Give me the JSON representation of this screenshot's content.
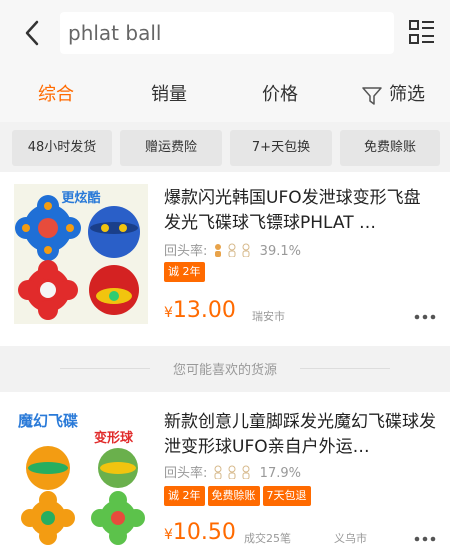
{
  "search": {
    "query": "phlat ball"
  },
  "icons": {
    "back": "chevron-left-icon",
    "list": "list-view-icon",
    "filter": "funnel-icon",
    "more": "more-dots-icon"
  },
  "tabs": [
    {
      "label": "综合"
    },
    {
      "label": "销量"
    },
    {
      "label": "价格"
    },
    {
      "label": "筛选"
    }
  ],
  "chips": [
    {
      "label": "48小时发货"
    },
    {
      "label": "赠运费险"
    },
    {
      "label": "7+天包换"
    },
    {
      "label": "免费赊账"
    }
  ],
  "products": [
    {
      "image_label": "更炫酷",
      "title": "爆款闪光韩国UFO发泄球变形飞盘发光飞碟球飞镖球PHLAT …",
      "repeat_label": "回头率:",
      "repeat_rate": "39.1%",
      "tags": [
        "诚 2年"
      ],
      "price": "13.00",
      "location": "瑞安市"
    },
    {
      "image_label": "魔幻飞碟",
      "image_label2": "变形球",
      "title": "新款创意儿童脚踩发光魔幻飞碟球发泄变形球UFO亲自户外运…",
      "repeat_label": "回头率:",
      "repeat_rate": "17.9%",
      "tags": [
        "诚 2年",
        "免费赊账",
        "7天包退"
      ],
      "price": "10.50",
      "sales": "成交25笔",
      "location": "义乌市"
    }
  ],
  "recommend": {
    "label": "您可能喜欢的货源"
  },
  "colors": {
    "accent": "#ff6a00",
    "bg": "#f2f2f2"
  }
}
